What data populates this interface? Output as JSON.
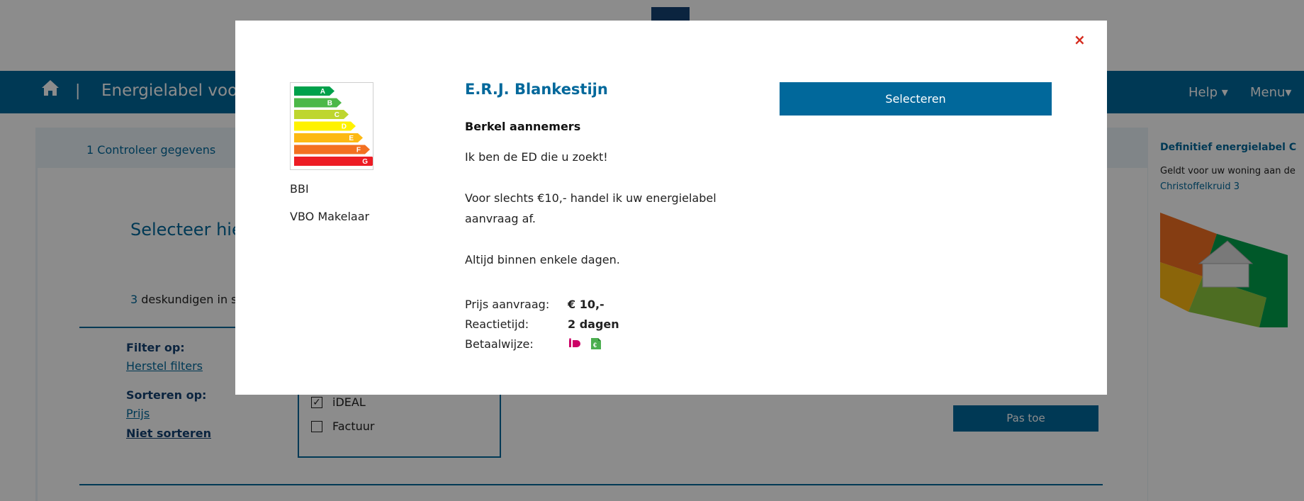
{
  "header": {
    "title": "Energielabel voor",
    "separator": "|",
    "help": "Help ▾",
    "menu": "Menu▾"
  },
  "steps": {
    "step1": "1 Controleer gegevens"
  },
  "main": {
    "select_title": "Selecteer hier",
    "count": "3",
    "count_text": " deskundigen in se",
    "filter_label": "Filter op:",
    "reset_filters": "Herstel filters",
    "sort_label": "Sorteren op:",
    "sort_price": "Prijs",
    "sort_none": "Niet sorteren",
    "payment_options": [
      {
        "label": "iDEAL",
        "checked": true
      },
      {
        "label": "Factuur",
        "checked": false
      }
    ],
    "apply_button": "Pas toe"
  },
  "sidebar": {
    "title": "Definitief energielabel C",
    "text": "Geldt voor uw woning aan de",
    "address": "Christoffelkruid 3"
  },
  "modal": {
    "close": "×",
    "label_classes": [
      "A",
      "B",
      "C",
      "D",
      "E",
      "F",
      "G"
    ],
    "organizations": [
      "BBI",
      "VBO Makelaar"
    ],
    "name": "E.R.J. Blankestijn",
    "company": "Berkel aannemers",
    "description": "Ik ben de ED die u zoekt!\n\nVoor slechts €10,- handel ik uw energielabel aanvraag af.\n\nAltijd binnen enkele dagen.",
    "price_label": "Prijs aanvraag:",
    "price_value": "€ 10,-",
    "response_label": "Reactietijd:",
    "response_value": "2 dagen",
    "payment_label": "Betaalwijze:",
    "payment_icons": [
      "ideal-icon",
      "invoice-icon"
    ],
    "select_button": "Selecteren"
  },
  "colors": {
    "brand_blue": "#01689b",
    "dark_blue": "#154273",
    "close_red": "#d52b1e",
    "label_colors": [
      "#00a14b",
      "#4cb848",
      "#bed630",
      "#fff200",
      "#fdb913",
      "#f37021",
      "#ed1c24"
    ]
  }
}
